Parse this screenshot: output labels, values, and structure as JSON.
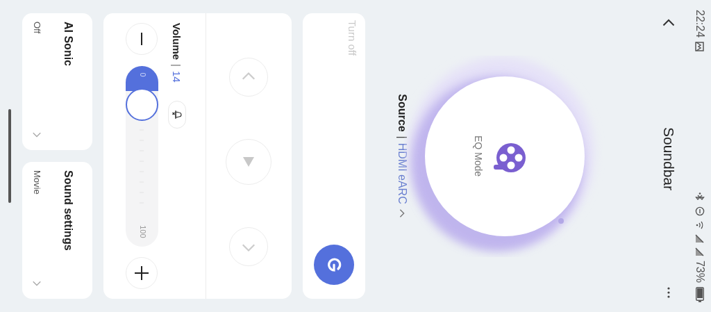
{
  "status_bar": {
    "time": "22:24",
    "battery": "73%"
  },
  "header": {
    "title": "Soundbar"
  },
  "eq": {
    "label": "EQ Mode"
  },
  "source": {
    "label": "Source",
    "separator": "|",
    "value": "HDMI eARC"
  },
  "power": {
    "label": "Turn off"
  },
  "volume": {
    "label": "Volume",
    "separator": "|",
    "value": "14",
    "level": 0.14,
    "min": "0",
    "max": "100"
  },
  "settings": [
    {
      "title": "AI Sonic",
      "value": "Off"
    },
    {
      "title": "Sound settings",
      "value": "Movie"
    }
  ]
}
